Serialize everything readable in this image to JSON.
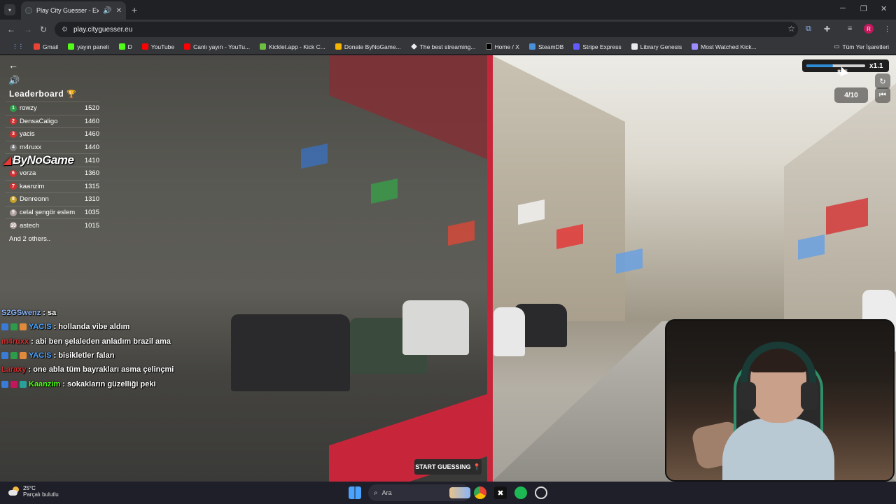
{
  "browser": {
    "tab_title": "Play City Guesser - Explore",
    "new_tab": "+",
    "url": "play.cityguesser.eu",
    "bookmarks": [
      {
        "label": "Gmail",
        "color": "#ea4335"
      },
      {
        "label": "yayın paneli",
        "color": "#53fc18"
      },
      {
        "label": "D",
        "color": "#53fc18"
      },
      {
        "label": "YouTube",
        "color": "#ff0000"
      },
      {
        "label": "Canlı yayın - YouTu...",
        "color": "#ff0000"
      },
      {
        "label": "Kicklet.app - Kick C...",
        "color": "#6cbf3f"
      },
      {
        "label": "Donate ByNoGame...",
        "color": "#f4b400"
      },
      {
        "label": "The best streaming...",
        "color": "#e8eaed"
      },
      {
        "label": "Home / X",
        "color": "#e8eaed"
      },
      {
        "label": "SteamDB",
        "color": "#4a90d9"
      },
      {
        "label": "Stripe Express",
        "color": "#635bff"
      },
      {
        "label": "Library Genesis",
        "color": "#e8eaed"
      },
      {
        "label": "Most Watched Kick...",
        "color": "#9b8cff"
      }
    ],
    "all_bookmarks": "Tüm Yer İşaretleri",
    "profile_initial": "R"
  },
  "game": {
    "leaderboard_title": "Leaderboard",
    "leaderboard": [
      {
        "rank": "1",
        "name": "rowzy",
        "score": "1520",
        "color": "#2e9b4a"
      },
      {
        "rank": "2",
        "name": "DensaCaligo",
        "score": "1460",
        "color": "#d32f2f"
      },
      {
        "rank": "3",
        "name": "yacis",
        "score": "1460",
        "color": "#d32f2f"
      },
      {
        "rank": "4",
        "name": "m4ruxx",
        "score": "1440",
        "color": "#7a7a7a"
      },
      {
        "rank": "5",
        "name": "",
        "score": "1410",
        "color": "#7a7a7a"
      },
      {
        "rank": "6",
        "name": "vorza",
        "score": "1360",
        "color": "#d32f2f"
      },
      {
        "rank": "7",
        "name": "kaanzim",
        "score": "1315",
        "color": "#d32f2f"
      },
      {
        "rank": "8",
        "name": "Denreonn",
        "score": "1310",
        "color": "#c9a227"
      },
      {
        "rank": "9",
        "name": "celal şengör eslem",
        "score": "1035",
        "color": "#b0a0a0"
      },
      {
        "rank": "10",
        "name": "astech",
        "score": "1015",
        "color": "#b0a0a0"
      }
    ],
    "others": "And 2 others..",
    "overlay_logo": "ByNoGame",
    "scale_label": "x1.1",
    "scale_fraction": 0.45,
    "score_partial": "845",
    "round": "4/10",
    "start_button": "START GUESSING"
  },
  "chat": [
    {
      "user": "S2GSwenz",
      "color": "#8ab4f8",
      "message": ": sa",
      "badges": []
    },
    {
      "user": "YACIS",
      "color": "#4aa3ff",
      "message": ": hollanda vibe aldım",
      "badges": [
        "#3a7bd5",
        "#2e9b4a",
        "#e08a3c"
      ]
    },
    {
      "user": "m4ruxx",
      "color": "#d32f2f",
      "message": ": abi ben şelaleden anladım brazil ama",
      "badges": []
    },
    {
      "user": "YACIS",
      "color": "#4aa3ff",
      "message": ": bisikletler falan",
      "badges": [
        "#3a7bd5",
        "#2e9b4a",
        "#e08a3c"
      ]
    },
    {
      "user": "Laraxy",
      "color": "#d32f2f",
      "message": ": one abla tüm bayrakları asma çelinçmi",
      "badges": []
    },
    {
      "user": "Kaanzim",
      "color": "#53fc18",
      "message": ": sokakların güzelliği peki",
      "badges": [
        "#3a7bd5",
        "#c2185b",
        "#2aa198"
      ]
    }
  ],
  "taskbar": {
    "temperature": "25°C",
    "weather": "Parçalı bulutlu",
    "search": "Ara"
  }
}
